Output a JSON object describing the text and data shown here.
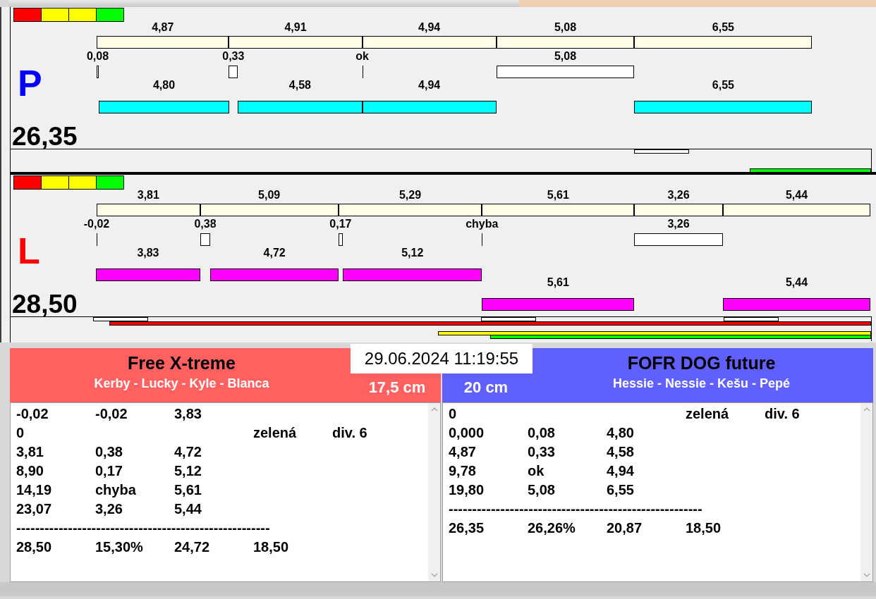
{
  "lanes": [
    {
      "letter": "P",
      "color": "#0000ff",
      "total": "26,35",
      "lights": [
        {
          "color": "#ff0000"
        },
        {
          "color": "#ffff00"
        },
        {
          "color": "#ffff00"
        },
        {
          "color": "#00ff00"
        }
      ],
      "legs": [
        {
          "time": "4,87",
          "crossing": "0,08"
        },
        {
          "time": "4,91",
          "crossing": "0,33"
        },
        {
          "time": "4,94",
          "crossing": "ok"
        },
        {
          "time": "5,08",
          "crossing": "5,08"
        },
        {
          "time": "6,55"
        }
      ],
      "dog_rows": [
        [
          "4,80",
          "4,58",
          "4,94",
          null,
          "6,55"
        ]
      ]
    },
    {
      "letter": "L",
      "color": "#ff0000",
      "total": "28,50",
      "lights": [
        {
          "color": "#ff0000"
        },
        {
          "color": "#ffff00"
        },
        {
          "color": "#ffff00"
        },
        {
          "color": "#00ff00"
        }
      ],
      "legs": [
        {
          "time": "3,81",
          "crossing": "-0,02"
        },
        {
          "time": "5,09",
          "crossing": "0,38"
        },
        {
          "time": "5,29",
          "crossing": "0,17"
        },
        {
          "time": "5,61",
          "crossing": "chyba"
        },
        {
          "time": "3,26",
          "crossing": "3,26"
        },
        {
          "time": "5,44"
        }
      ],
      "dog_rows": [
        [
          "3,83",
          "4,72",
          "5,12",
          null,
          null,
          null
        ],
        [
          null,
          null,
          null,
          "5,61",
          null,
          "5,44"
        ]
      ]
    }
  ],
  "timestamp": "29.06.2024 11:19:55",
  "teams": [
    {
      "name": "Free X-treme",
      "dogs": "Kerby - Lucky - Kyle - Blanca",
      "height": "17,5 cm",
      "color": "#ff6060",
      "rows": [
        {
          "kind": "values",
          "cells": [
            "-0,02",
            "-0,02",
            "3,83",
            null,
            null
          ]
        },
        {
          "kind": "values",
          "cells": [
            "0",
            null,
            null,
            "zelená",
            "div. 6"
          ]
        },
        {
          "kind": "values",
          "cells": [
            "3,81",
            "0,38",
            "4,72",
            null,
            null
          ]
        },
        {
          "kind": "values",
          "cells": [
            "8,90",
            "0,17",
            "5,12",
            null,
            null
          ]
        },
        {
          "kind": "values",
          "cells": [
            "14,19",
            "chyba",
            "5,61",
            null,
            null
          ]
        },
        {
          "kind": "values",
          "cells": [
            "23,07",
            "3,26",
            "5,44",
            null,
            null
          ]
        },
        {
          "kind": "rule",
          "text": "------------------------------------------------------"
        },
        {
          "kind": "values",
          "cells": [
            "28,50",
            "15,30%",
            "24,72",
            "18,50",
            null
          ]
        }
      ]
    },
    {
      "name": "FOFR DOG future",
      "dogs": "Hessie - Nessie - Kešu - Pepé",
      "height": "20 cm",
      "color": "#6060ff",
      "rows": [
        {
          "kind": "values",
          "cells": [
            "0",
            null,
            null,
            "zelená",
            "div. 6"
          ]
        },
        {
          "kind": "values",
          "cells": [
            "0,000",
            "0,08",
            "4,80",
            null,
            null
          ]
        },
        {
          "kind": "values",
          "cells": [
            "4,87",
            "0,33",
            "4,58",
            null,
            null
          ]
        },
        {
          "kind": "values",
          "cells": [
            "9,78",
            "ok",
            "4,94",
            null,
            null
          ]
        },
        {
          "kind": "values",
          "cells": [
            "19,80",
            "5,08",
            "6,55",
            null,
            null
          ]
        },
        {
          "kind": "rule",
          "text": "------------------------------------------------------"
        },
        {
          "kind": "values",
          "cells": [
            "26,35",
            "26,26%",
            "20,87",
            "18,50",
            null
          ]
        }
      ]
    }
  ]
}
